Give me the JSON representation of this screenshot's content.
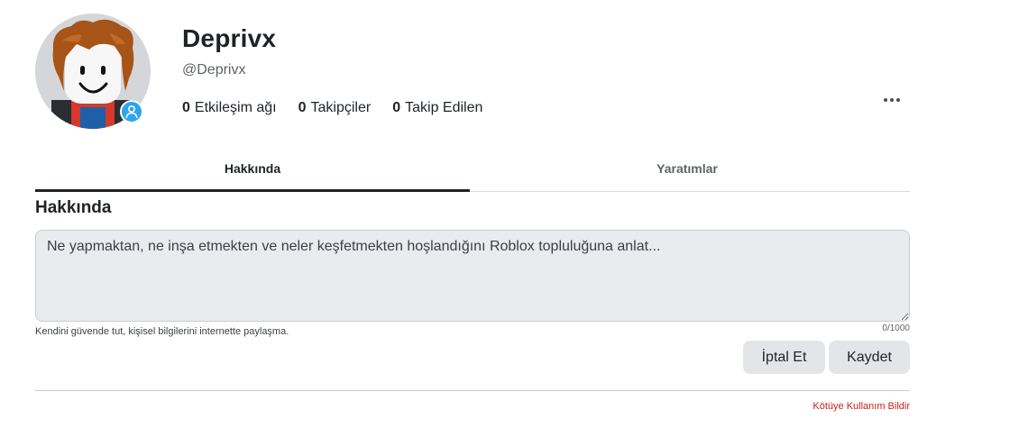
{
  "profile": {
    "display_name": "Deprivx",
    "username": "@Deprivx",
    "avatar_icon": "avatar-image",
    "status_icon": "user-icon",
    "status_color": "#2ca5ec"
  },
  "stats": [
    {
      "count": "0",
      "label": "Etkileşim ağı"
    },
    {
      "count": "0",
      "label": "Takipçiler"
    },
    {
      "count": "0",
      "label": "Takip Edilen"
    }
  ],
  "tabs": [
    {
      "label": "Hakkında",
      "active": true
    },
    {
      "label": "Yaratımlar",
      "active": false
    }
  ],
  "about": {
    "title": "Hakkında",
    "placeholder": "Ne yapmaktan, ne inşa etmekten ve neler keşfetmekten hoşlandığını Roblox topluluğuna anlat...",
    "value": "",
    "helper": "Kendini güvende tut, kişisel bilgilerini internette paylaşma.",
    "counter": "0/1000",
    "cancel_label": "İptal Et",
    "save_label": "Kaydet"
  },
  "footer": {
    "report_label": "Kötüye Kullanım Bildir",
    "report_color": "#c8211b"
  }
}
